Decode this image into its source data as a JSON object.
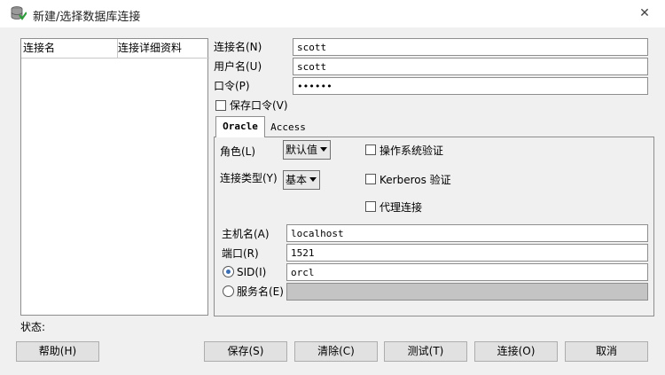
{
  "window": {
    "title": "新建/选择数据库连接",
    "close_symbol": "✕"
  },
  "connection_list": {
    "columns": [
      "连接名",
      "连接详细资料"
    ],
    "rows": []
  },
  "form": {
    "conn_name": {
      "label": "连接名(N)",
      "value": "scott"
    },
    "username": {
      "label": "用户名(U)",
      "value": "scott"
    },
    "password": {
      "label": "口令(P)",
      "value": "••••••"
    },
    "save_password": {
      "label": "保存口令(V)",
      "checked": false
    }
  },
  "tabs": [
    {
      "label": "Oracle",
      "active": true
    },
    {
      "label": "Access",
      "active": false
    }
  ],
  "oracle": {
    "role": {
      "label": "角色(L)",
      "value": "默认值"
    },
    "conn_type": {
      "label": "连接类型(Y)",
      "value": "基本"
    },
    "os_auth": {
      "label": "操作系统验证",
      "checked": false
    },
    "kerberos_auth": {
      "label": "Kerberos 验证",
      "checked": false
    },
    "proxy_conn": {
      "label": "代理连接",
      "checked": false
    },
    "hostname": {
      "label": "主机名(A)",
      "value": "localhost"
    },
    "port": {
      "label": "端口(R)",
      "value": "1521"
    },
    "sid": {
      "label": "SID(I)",
      "value": "orcl",
      "selected": true
    },
    "service_name": {
      "label": "服务名(E)",
      "value": "",
      "selected": false
    }
  },
  "status": {
    "label": "状态:"
  },
  "buttons": {
    "help": "帮助(H)",
    "save": "保存(S)",
    "clear": "清除(C)",
    "test": "测试(T)",
    "connect": "连接(O)",
    "cancel": "取消"
  },
  "colors": {
    "background": "#f0f0f0",
    "field_border": "#8e8e8e",
    "disabled_field": "#c4c4c4",
    "radio_selected": "#3a6fb5"
  }
}
